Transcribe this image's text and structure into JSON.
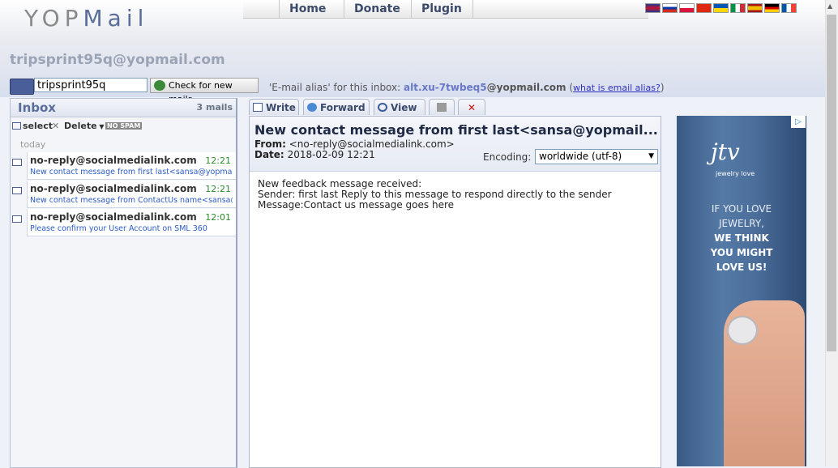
{
  "logo": {
    "left": "YOP",
    "right": "Mail"
  },
  "nav": {
    "items": [
      "Home",
      "Donate",
      "Plugin"
    ]
  },
  "flags": [
    {
      "name": "uk-flag",
      "colors": [
        "#1f3a93",
        "#c8102e"
      ]
    },
    {
      "name": "ru-flag",
      "colors": [
        "#ffffff",
        "#0039a6",
        "#d52b1e"
      ]
    },
    {
      "name": "pl-flag",
      "colors": [
        "#ffffff",
        "#dc143c"
      ]
    },
    {
      "name": "cn-flag",
      "colors": [
        "#de2910",
        "#de2910"
      ]
    },
    {
      "name": "ua-flag",
      "colors": [
        "#0057b7",
        "#ffd700"
      ]
    },
    {
      "name": "it-flag",
      "colors": [
        "#009246",
        "#ffffff",
        "#ce2b37"
      ]
    },
    {
      "name": "es-flag",
      "colors": [
        "#aa151b",
        "#f1bf00",
        "#aa151b"
      ]
    },
    {
      "name": "de-flag",
      "colors": [
        "#000000",
        "#dd0000",
        "#ffce00"
      ]
    },
    {
      "name": "fr-flag",
      "colors": [
        "#0055a4",
        "#ffffff",
        "#ef4135"
      ]
    }
  ],
  "user_email": "tripsprint95q@yopmail.com",
  "login": {
    "value": "tripsprint95q",
    "check_label": "Check for new mails"
  },
  "alias": {
    "prefix": "'E-mail alias' for this inbox:",
    "alias_name": "alt.xu-7twbeq5",
    "alias_domain": "@yopmail.com",
    "open_paren": "(",
    "link": "what is email alias?",
    "close_paren": ")"
  },
  "inbox": {
    "title": "Inbox",
    "count": "3 mails",
    "tools": {
      "select": "select",
      "delete": "Delete",
      "nospam": "NO SPAM"
    },
    "group": "today",
    "mails": [
      {
        "from": "no-reply@socialmedialink.com",
        "time": "12:21",
        "subject": "New contact message from first last<sansa@yopmail...."
      },
      {
        "from": "no-reply@socialmedialink.com",
        "time": "12:21",
        "subject": "New contact message from ContactUs name<sansa@..."
      },
      {
        "from": "no-reply@socialmedialink.com",
        "time": "12:01",
        "subject": "Please confirm your User Account on SML 360"
      }
    ]
  },
  "tabs": {
    "write": "Write",
    "forward": "Forward",
    "view": "View"
  },
  "message": {
    "subject": "New contact message from first last<sansa@yopmail...",
    "from_label": "From:",
    "from_value": "<no-reply@socialmedialink.com>",
    "date_label": "Date:",
    "date_value": "2018-02-09 12:21",
    "encoding_label": "Encoding:",
    "encoding_value": "worldwide (utf-8)",
    "body": [
      "New feedback message received:",
      "Sender: first last Reply to this message to respond directly to the sender",
      "Message:Contact us message goes here"
    ]
  },
  "ad": {
    "logo": "jtv",
    "sub": "jewelry love",
    "lines": [
      "IF YOU LOVE",
      "JEWELRY,",
      "WE THINK",
      "YOU MIGHT",
      "LOVE US!"
    ]
  },
  "colors": {
    "accent": "#5a6e9a",
    "link": "#2c5cc8",
    "time": "#2a8a2a"
  }
}
